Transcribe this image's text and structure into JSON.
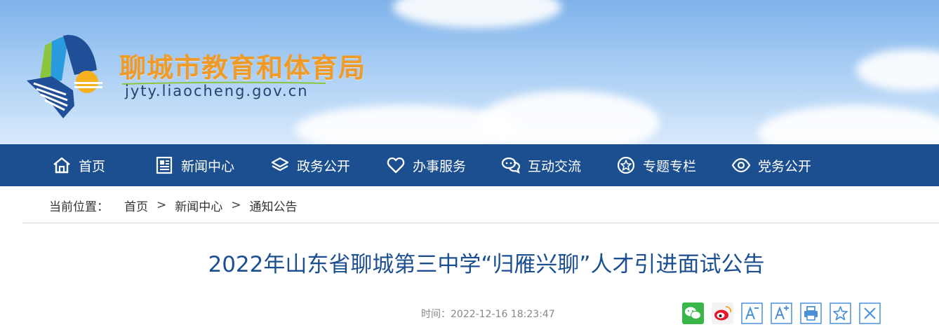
{
  "header": {
    "site_name": "聊城市教育和体育局",
    "site_url": "jyty.liaocheng.gov.cn"
  },
  "nav": {
    "items": [
      {
        "label": "首页",
        "icon": "home-icon"
      },
      {
        "label": "新闻中心",
        "icon": "newspaper-icon"
      },
      {
        "label": "政务公开",
        "icon": "layers-icon"
      },
      {
        "label": "办事服务",
        "icon": "heart-icon"
      },
      {
        "label": "互动交流",
        "icon": "chat-icon"
      },
      {
        "label": "专题专栏",
        "icon": "star-badge-icon"
      },
      {
        "label": "党务公开",
        "icon": "eye-icon"
      }
    ]
  },
  "breadcrumb": {
    "label": "当前位置：",
    "items": [
      "首页",
      "新闻中心",
      "通知公告"
    ],
    "separator": ">"
  },
  "article": {
    "title": "2022年山东省聊城第三中学“归雁兴聊”人才引进面试公告",
    "time_label": "时间：",
    "time_value": "2022-12-16 18:23:47"
  },
  "tools": [
    {
      "icon": "wechat-share-icon"
    },
    {
      "icon": "weibo-share-icon"
    },
    {
      "icon": "font-decrease-icon"
    },
    {
      "icon": "font-increase-icon"
    },
    {
      "icon": "print-icon"
    },
    {
      "icon": "favorite-icon"
    },
    {
      "icon": "close-icon"
    }
  ],
  "colors": {
    "nav_bg": "#1c4f8f",
    "title": "#1c4f8f",
    "site_name": "#f09a28",
    "tool_border": "#4a90d9"
  }
}
